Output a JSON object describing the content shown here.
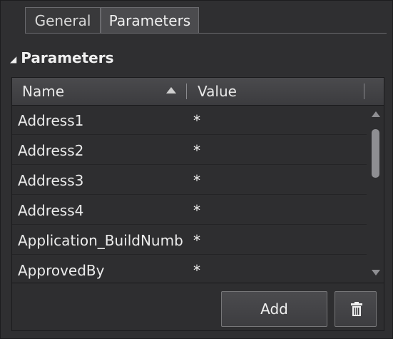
{
  "tabs": [
    {
      "label": "General"
    },
    {
      "label": "Parameters"
    }
  ],
  "section": {
    "title": "Parameters"
  },
  "table": {
    "columns": [
      "Name",
      "Value"
    ],
    "rows": [
      {
        "name": "Address1",
        "value": "*"
      },
      {
        "name": "Address2",
        "value": "*"
      },
      {
        "name": "Address3",
        "value": "*"
      },
      {
        "name": "Address4",
        "value": "*"
      },
      {
        "name": "Application_BuildNumb",
        "value": "*"
      },
      {
        "name": "ApprovedBy",
        "value": "*"
      }
    ]
  },
  "buttons": {
    "add_label": "Add"
  },
  "icons": {
    "section_toggle": "collapse-triangle-icon",
    "sort": "sort-ascending-icon",
    "delete": "trash-icon"
  }
}
